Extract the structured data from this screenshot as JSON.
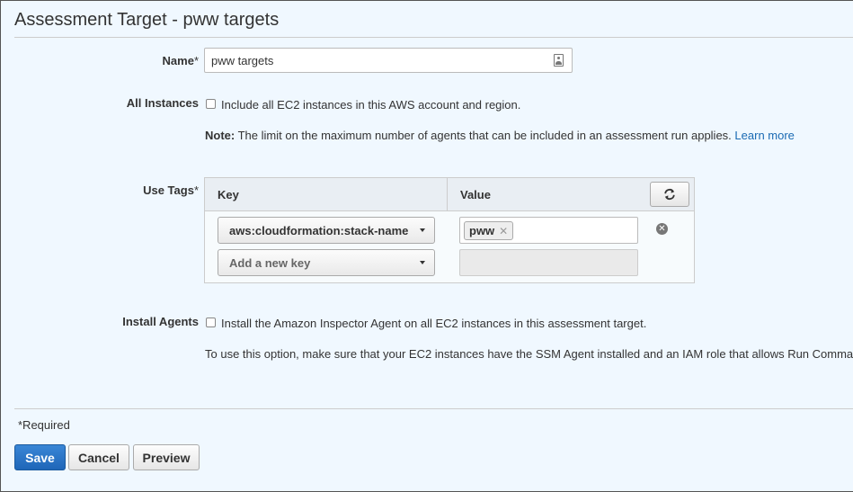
{
  "header": {
    "title": "Assessment Target - pww targets"
  },
  "form": {
    "name": {
      "label": "Name",
      "required_mark": "*",
      "value": "pww targets"
    },
    "all_instances": {
      "label": "All Instances",
      "checkbox_label": "Include all EC2 instances in this AWS account and region.",
      "checked": false,
      "note_prefix": "Note:",
      "note_text": "The limit on the maximum number of agents that can be included in an assessment run applies.",
      "learn_more": "Learn more"
    },
    "use_tags": {
      "label": "Use Tags",
      "required_mark": "*",
      "col_key": "Key",
      "col_value": "Value",
      "refresh_icon": "refresh-icon",
      "rows": [
        {
          "key": "aws:cloudformation:stack-name",
          "value_chip": "pww"
        }
      ],
      "add_key_placeholder": "Add a new key"
    },
    "install_agents": {
      "label": "Install Agents",
      "checkbox_label": "Install the Amazon Inspector Agent on all EC2 instances in this assessment target.",
      "checked": false,
      "info_text": "To use this option, make sure that your EC2 instances have the SSM Agent installed and an IAM role that allows Run Command."
    }
  },
  "footer": {
    "required_note": "*Required",
    "save_label": "Save",
    "cancel_label": "Cancel",
    "preview_label": "Preview"
  },
  "colors": {
    "background": "#f0f8ff",
    "primary": "#1f66b8",
    "link": "#1a6ab3"
  }
}
